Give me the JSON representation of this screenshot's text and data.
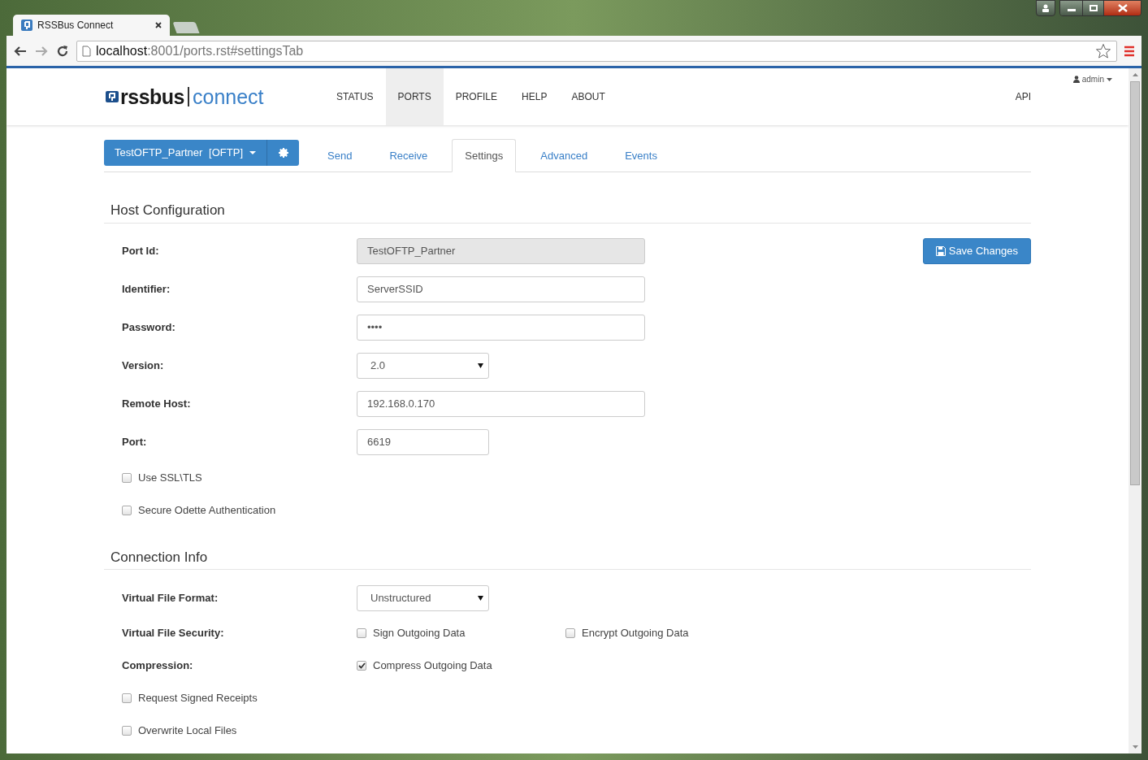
{
  "browser": {
    "tab_title": "RSSBus Connect",
    "url_host": "localhost",
    "url_rest": ":8001/ports.rst#settingsTab"
  },
  "header": {
    "logo_left": "rssbus",
    "logo_right": "connect",
    "user": "admin",
    "api": "API",
    "nav": [
      {
        "label": "STATUS",
        "selected": false
      },
      {
        "label": "PORTS",
        "selected": true
      },
      {
        "label": "PROFILE",
        "selected": false
      },
      {
        "label": "HELP",
        "selected": false
      },
      {
        "label": "ABOUT",
        "selected": false
      }
    ]
  },
  "port_button": {
    "name": "TestOFTP_Partner",
    "type": "[OFTP]"
  },
  "tabs": [
    {
      "label": "Send",
      "selected": false
    },
    {
      "label": "Receive",
      "selected": false
    },
    {
      "label": "Settings",
      "selected": true
    },
    {
      "label": "Advanced",
      "selected": false
    },
    {
      "label": "Events",
      "selected": false
    }
  ],
  "save_button": "Save Changes",
  "sections": [
    {
      "title": "Host Configuration",
      "rows": [
        {
          "kind": "text",
          "label": "Port Id:",
          "value": "TestOFTP_Partner",
          "disabled": true
        },
        {
          "kind": "text",
          "label": "Identifier:",
          "value": "ServerSSID",
          "disabled": false
        },
        {
          "kind": "text",
          "label": "Password:",
          "value": "••••",
          "disabled": false
        },
        {
          "kind": "select",
          "label": "Version:",
          "value": "2.0"
        },
        {
          "kind": "text",
          "label": "Remote Host:",
          "value": "192.168.0.170",
          "disabled": false
        },
        {
          "kind": "number",
          "label": "Port:",
          "value": "6619"
        },
        {
          "kind": "checkbox",
          "label": "Use SSL\\TLS",
          "checked": false
        },
        {
          "kind": "checkbox",
          "label": "Secure Odette Authentication",
          "checked": false
        }
      ]
    },
    {
      "title": "Connection Info",
      "rows": [
        {
          "kind": "select",
          "label": "Virtual File Format:",
          "value": "Unstructured"
        },
        {
          "kind": "options",
          "label": "Virtual File Security:",
          "options": [
            {
              "label": "Sign Outgoing Data",
              "checked": false
            },
            {
              "label": "Encrypt Outgoing Data",
              "checked": false
            }
          ]
        },
        {
          "kind": "options",
          "label": "Compression:",
          "options": [
            {
              "label": "Compress Outgoing Data",
              "checked": true
            }
          ]
        },
        {
          "kind": "checkbox",
          "label": "Request Signed Receipts",
          "checked": false
        },
        {
          "kind": "checkbox",
          "label": "Overwrite Local Files",
          "checked": false
        }
      ]
    }
  ]
}
